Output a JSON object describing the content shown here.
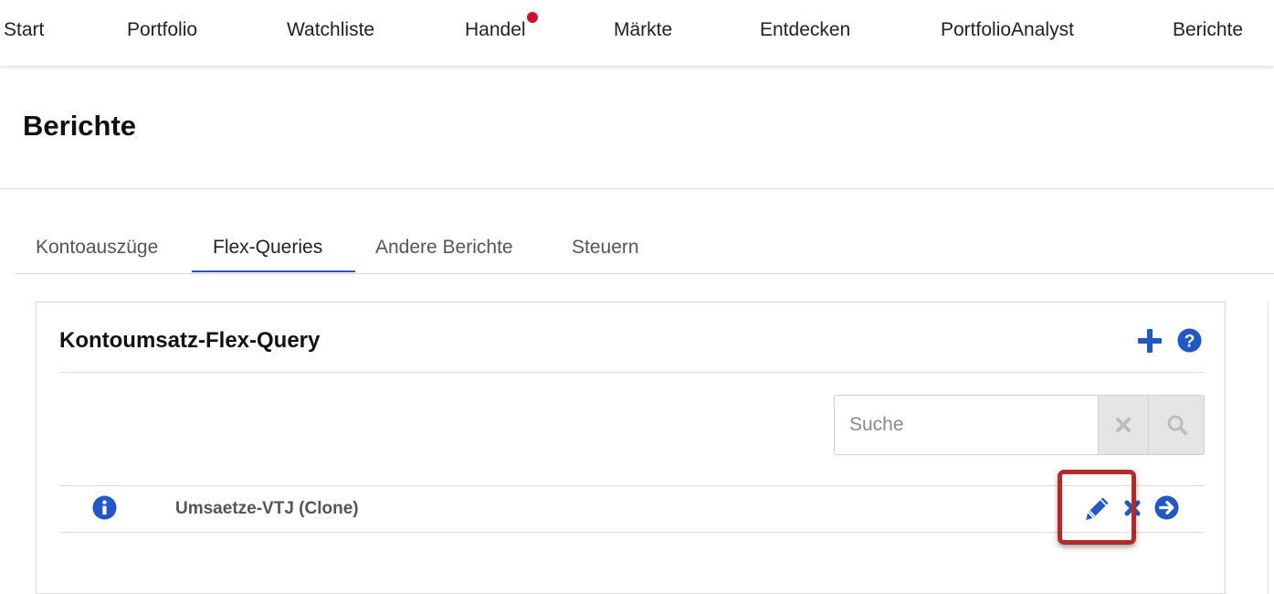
{
  "theme": {
    "accent": "#2157c7",
    "notification_dot": "#d0102e",
    "highlight": "#b22a2a",
    "muted_icon": "#bdbdbd"
  },
  "topnav": {
    "items": [
      {
        "label": "Start"
      },
      {
        "label": "Portfolio"
      },
      {
        "label": "Watchliste"
      },
      {
        "label": "Handel",
        "has_notification": true
      },
      {
        "label": "Märkte"
      },
      {
        "label": "Entdecken"
      },
      {
        "label": "PortfolioAnalyst"
      },
      {
        "label": "Berichte"
      }
    ]
  },
  "page": {
    "title": "Berichte"
  },
  "tabs": [
    {
      "label": "Kontoauszüge",
      "active": false
    },
    {
      "label": "Flex-Queries",
      "active": true
    },
    {
      "label": "Andere Berichte",
      "active": false
    },
    {
      "label": "Steuern",
      "active": false
    }
  ],
  "card": {
    "title": "Kontoumsatz-Flex-Query",
    "header_icons": [
      "plus-icon",
      "help-circle-icon"
    ],
    "search": {
      "placeholder": "Suche",
      "value": "",
      "clear_icon": "clear-x-icon",
      "search_icon": "magnifier-icon"
    },
    "rows": [
      {
        "name": "Umsaetze-VTJ (Clone)",
        "icons": [
          "info-icon",
          "pencil-icon",
          "delete-x-icon",
          "run-arrow-icon"
        ]
      }
    ]
  }
}
